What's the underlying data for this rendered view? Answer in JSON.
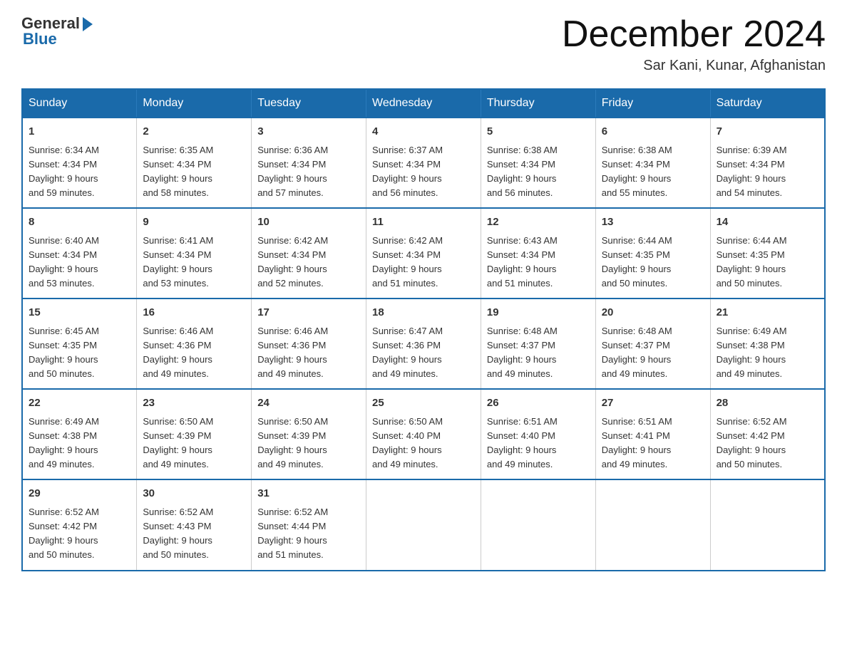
{
  "header": {
    "logo_general": "General",
    "logo_blue": "Blue",
    "month_title": "December 2024",
    "location": "Sar Kani, Kunar, Afghanistan"
  },
  "days_of_week": [
    "Sunday",
    "Monday",
    "Tuesday",
    "Wednesday",
    "Thursday",
    "Friday",
    "Saturday"
  ],
  "weeks": [
    [
      {
        "day": "1",
        "sunrise": "6:34 AM",
        "sunset": "4:34 PM",
        "daylight": "9 hours and 59 minutes."
      },
      {
        "day": "2",
        "sunrise": "6:35 AM",
        "sunset": "4:34 PM",
        "daylight": "9 hours and 58 minutes."
      },
      {
        "day": "3",
        "sunrise": "6:36 AM",
        "sunset": "4:34 PM",
        "daylight": "9 hours and 57 minutes."
      },
      {
        "day": "4",
        "sunrise": "6:37 AM",
        "sunset": "4:34 PM",
        "daylight": "9 hours and 56 minutes."
      },
      {
        "day": "5",
        "sunrise": "6:38 AM",
        "sunset": "4:34 PM",
        "daylight": "9 hours and 56 minutes."
      },
      {
        "day": "6",
        "sunrise": "6:38 AM",
        "sunset": "4:34 PM",
        "daylight": "9 hours and 55 minutes."
      },
      {
        "day": "7",
        "sunrise": "6:39 AM",
        "sunset": "4:34 PM",
        "daylight": "9 hours and 54 minutes."
      }
    ],
    [
      {
        "day": "8",
        "sunrise": "6:40 AM",
        "sunset": "4:34 PM",
        "daylight": "9 hours and 53 minutes."
      },
      {
        "day": "9",
        "sunrise": "6:41 AM",
        "sunset": "4:34 PM",
        "daylight": "9 hours and 53 minutes."
      },
      {
        "day": "10",
        "sunrise": "6:42 AM",
        "sunset": "4:34 PM",
        "daylight": "9 hours and 52 minutes."
      },
      {
        "day": "11",
        "sunrise": "6:42 AM",
        "sunset": "4:34 PM",
        "daylight": "9 hours and 51 minutes."
      },
      {
        "day": "12",
        "sunrise": "6:43 AM",
        "sunset": "4:34 PM",
        "daylight": "9 hours and 51 minutes."
      },
      {
        "day": "13",
        "sunrise": "6:44 AM",
        "sunset": "4:35 PM",
        "daylight": "9 hours and 50 minutes."
      },
      {
        "day": "14",
        "sunrise": "6:44 AM",
        "sunset": "4:35 PM",
        "daylight": "9 hours and 50 minutes."
      }
    ],
    [
      {
        "day": "15",
        "sunrise": "6:45 AM",
        "sunset": "4:35 PM",
        "daylight": "9 hours and 50 minutes."
      },
      {
        "day": "16",
        "sunrise": "6:46 AM",
        "sunset": "4:36 PM",
        "daylight": "9 hours and 49 minutes."
      },
      {
        "day": "17",
        "sunrise": "6:46 AM",
        "sunset": "4:36 PM",
        "daylight": "9 hours and 49 minutes."
      },
      {
        "day": "18",
        "sunrise": "6:47 AM",
        "sunset": "4:36 PM",
        "daylight": "9 hours and 49 minutes."
      },
      {
        "day": "19",
        "sunrise": "6:48 AM",
        "sunset": "4:37 PM",
        "daylight": "9 hours and 49 minutes."
      },
      {
        "day": "20",
        "sunrise": "6:48 AM",
        "sunset": "4:37 PM",
        "daylight": "9 hours and 49 minutes."
      },
      {
        "day": "21",
        "sunrise": "6:49 AM",
        "sunset": "4:38 PM",
        "daylight": "9 hours and 49 minutes."
      }
    ],
    [
      {
        "day": "22",
        "sunrise": "6:49 AM",
        "sunset": "4:38 PM",
        "daylight": "9 hours and 49 minutes."
      },
      {
        "day": "23",
        "sunrise": "6:50 AM",
        "sunset": "4:39 PM",
        "daylight": "9 hours and 49 minutes."
      },
      {
        "day": "24",
        "sunrise": "6:50 AM",
        "sunset": "4:39 PM",
        "daylight": "9 hours and 49 minutes."
      },
      {
        "day": "25",
        "sunrise": "6:50 AM",
        "sunset": "4:40 PM",
        "daylight": "9 hours and 49 minutes."
      },
      {
        "day": "26",
        "sunrise": "6:51 AM",
        "sunset": "4:40 PM",
        "daylight": "9 hours and 49 minutes."
      },
      {
        "day": "27",
        "sunrise": "6:51 AM",
        "sunset": "4:41 PM",
        "daylight": "9 hours and 49 minutes."
      },
      {
        "day": "28",
        "sunrise": "6:52 AM",
        "sunset": "4:42 PM",
        "daylight": "9 hours and 50 minutes."
      }
    ],
    [
      {
        "day": "29",
        "sunrise": "6:52 AM",
        "sunset": "4:42 PM",
        "daylight": "9 hours and 50 minutes."
      },
      {
        "day": "30",
        "sunrise": "6:52 AM",
        "sunset": "4:43 PM",
        "daylight": "9 hours and 50 minutes."
      },
      {
        "day": "31",
        "sunrise": "6:52 AM",
        "sunset": "4:44 PM",
        "daylight": "9 hours and 51 minutes."
      },
      null,
      null,
      null,
      null
    ]
  ],
  "labels": {
    "sunrise": "Sunrise:",
    "sunset": "Sunset:",
    "daylight": "Daylight:"
  }
}
